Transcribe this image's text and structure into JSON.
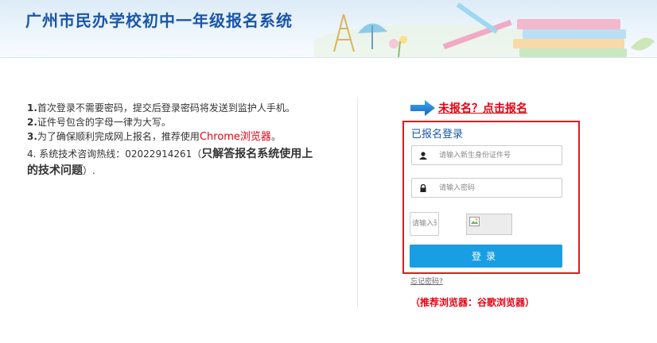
{
  "header": {
    "title": "广州市民办学校初中一年级报名系统"
  },
  "instructions": {
    "line1_num": "1.",
    "line1_text": "首次登录不需要密码，提交后登录密码将发送到监护人手机。",
    "line2_num": "2.",
    "line2_text": "证件号包含的字母一律为大写。",
    "line3_num": "3.",
    "line3_text": "为了确保顺利完成网上报名，推荐使用",
    "line3_highlight": "Chrome浏览器",
    "line3_end": "。",
    "line4_prefix": "4. 系统技术咨询热线：02022914261（",
    "line4_bold": "只解答报名系统使用上的技术问题",
    "line4_suffix": "）."
  },
  "register": {
    "link_label": "未报名？点击报名"
  },
  "login": {
    "title": "已报名登录",
    "id_placeholder": "请输入新生身份证件号",
    "password_placeholder": "请输入密码",
    "captcha_placeholder": "请输入验证码",
    "button_label": "登录",
    "forgot_label": "忘记密码?"
  },
  "browser_note": "（推荐浏览器：谷歌浏览器）",
  "colors": {
    "title_blue": "#1a56a8",
    "accent_red": "#e60012",
    "button_blue": "#1a9ee3",
    "box_border_red": "#d81e1e"
  }
}
